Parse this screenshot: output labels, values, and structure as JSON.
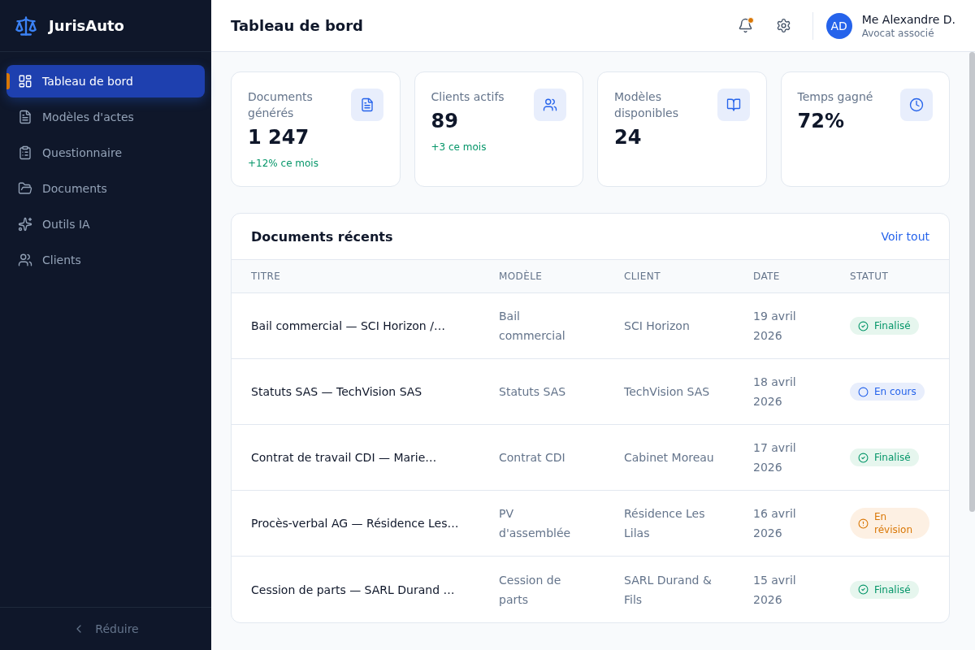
{
  "sidebar": {
    "brand": "JurisAuto",
    "nav": [
      {
        "label": "Tableau de bord",
        "selected": true
      },
      {
        "label": "Modèles d'actes",
        "selected": false
      },
      {
        "label": "Questionnaire",
        "selected": false
      },
      {
        "label": "Documents",
        "selected": false
      },
      {
        "label": "Outils IA",
        "selected": false
      },
      {
        "label": "Clients",
        "selected": false
      }
    ],
    "collapse": "Réduire"
  },
  "header": {
    "title": "Tableau de bord",
    "notifications": {
      "unread": true
    },
    "user": {
      "initials": "AD",
      "name": "Me Alexandre D.",
      "role": "Avocat associé"
    }
  },
  "stats": [
    {
      "label": "Documents générés",
      "value": "1 247",
      "change": "+12% ce mois"
    },
    {
      "label": "Clients actifs",
      "value": "89",
      "change": "+3 ce mois"
    },
    {
      "label": "Modèles disponibles",
      "value": "24"
    },
    {
      "label": "Temps gagné",
      "value": "72%"
    }
  ],
  "recent_documents": {
    "title": "Documents récents",
    "link": "Voir tout",
    "columns": [
      "TITRE",
      "MODÈLE",
      "CLIENT",
      "DATE",
      "STATUT"
    ],
    "rows": [
      {
        "title": "Bail commercial — SCI Horizon /…",
        "model": "Bail commercial",
        "client": "SCI Horizon",
        "date": "19 avril 2026",
        "status": {
          "kind": "done",
          "label": "Finalisé"
        }
      },
      {
        "title": "Statuts SAS — TechVision SAS",
        "model": "Statuts SAS",
        "client": "TechVision SAS",
        "date": "18 avril 2026",
        "status": {
          "kind": "progress",
          "label": "En cours"
        }
      },
      {
        "title": "Contrat de travail CDI — Marie…",
        "model": "Contrat CDI",
        "client": "Cabinet Moreau",
        "date": "17 avril 2026",
        "status": {
          "kind": "done",
          "label": "Finalisé"
        }
      },
      {
        "title": "Procès-verbal AG — Résidence Les…",
        "model": "PV d'assemblée",
        "client": "Résidence Les Lilas",
        "date": "16 avril 2026",
        "status": {
          "kind": "review",
          "label": "En révision"
        }
      },
      {
        "title": "Cession de parts — SARL Durand …",
        "model": "Cession de parts",
        "client": "SARL Durand & Fils",
        "date": "15 avril 2026",
        "status": {
          "kind": "done",
          "label": "Finalisé"
        }
      }
    ]
  }
}
